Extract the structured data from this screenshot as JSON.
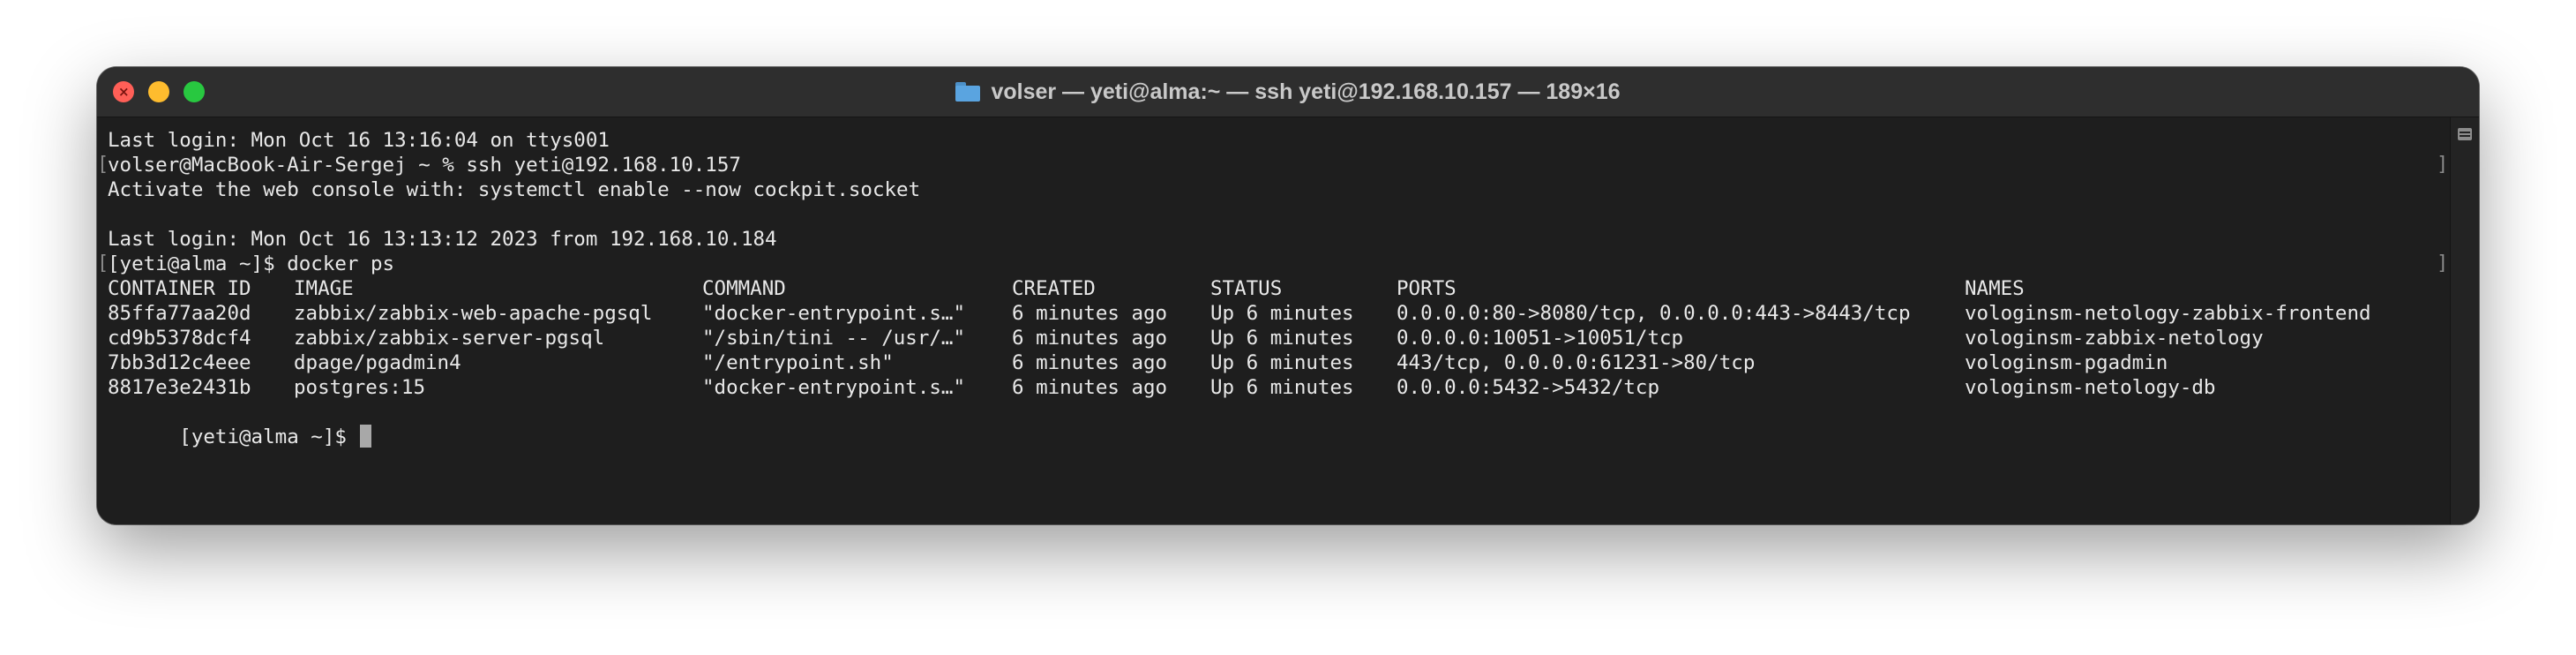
{
  "window": {
    "title": "volser — yeti@alma:~ — ssh yeti@192.168.10.157 — 189×16",
    "folder_icon": "folder-icon",
    "traffic_lights": {
      "close": "#ff5f57",
      "minimize": "#febc2e",
      "zoom": "#28c840"
    }
  },
  "terminal": {
    "lines": [
      "Last login: Mon Oct 16 13:16:04 on ttys001",
      "volser@MacBook-Air-Sergej ~ % ssh yeti@192.168.10.157",
      "Activate the web console with: systemctl enable --now cockpit.socket",
      "",
      "Last login: Mon Oct 16 13:13:12 2023 from 192.168.10.184",
      "[yeti@alma ~]$ docker ps"
    ],
    "table": {
      "headers": [
        "CONTAINER ID",
        "IMAGE",
        "COMMAND",
        "CREATED",
        "STATUS",
        "PORTS",
        "NAMES"
      ],
      "rows": [
        [
          "85ffa77aa20d",
          "zabbix/zabbix-web-apache-pgsql",
          "\"docker-entrypoint.s…\"",
          "6 minutes ago",
          "Up 6 minutes",
          "0.0.0.0:80->8080/tcp, 0.0.0.0:443->8443/tcp",
          "vologinsm-netology-zabbix-frontend"
        ],
        [
          "cd9b5378dcf4",
          "zabbix/zabbix-server-pgsql",
          "\"/sbin/tini -- /usr/…\"",
          "6 minutes ago",
          "Up 6 minutes",
          "0.0.0.0:10051->10051/tcp",
          "vologinsm-zabbix-netology"
        ],
        [
          "7bb3d12c4eee",
          "dpage/pgadmin4",
          "\"/entrypoint.sh\"",
          "6 minutes ago",
          "Up 6 minutes",
          "443/tcp, 0.0.0.0:61231->80/tcp",
          "vologinsm-pgadmin"
        ],
        [
          "8817e3e2431b",
          "postgres:15",
          "\"docker-entrypoint.s…\"",
          "6 minutes ago",
          "Up 6 minutes",
          "0.0.0.0:5432->5432/tcp",
          "vologinsm-netology-db"
        ]
      ]
    },
    "prompt": "[yeti@alma ~]$",
    "colors": {
      "background": "#1e1e1e",
      "text": "#e8e8e8",
      "cursor": "#a8a8a8"
    }
  }
}
